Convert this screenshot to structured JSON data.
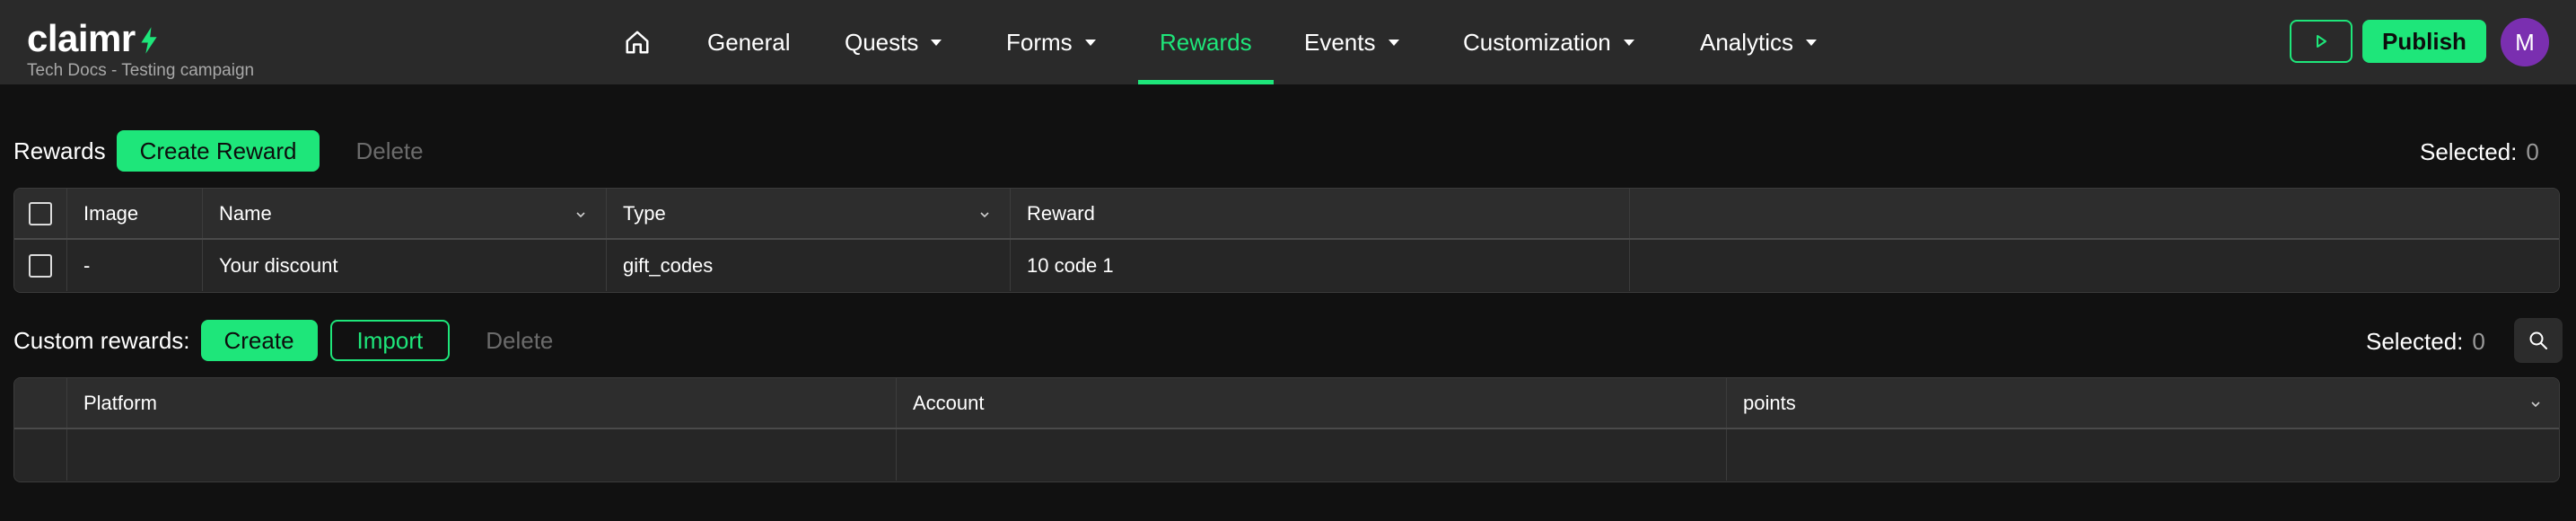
{
  "header": {
    "logo_text": "claimr",
    "subtitle": "Tech Docs - Testing campaign",
    "nav": [
      {
        "label": "General",
        "caret": false
      },
      {
        "label": "Quests",
        "caret": true
      },
      {
        "label": "Forms",
        "caret": true
      },
      {
        "label": "Rewards",
        "caret": false,
        "active": true
      },
      {
        "label": "Events",
        "caret": true
      },
      {
        "label": "Customization",
        "caret": true
      },
      {
        "label": "Analytics",
        "caret": true
      }
    ],
    "publish_label": "Publish",
    "avatar_initial": "M"
  },
  "rewards": {
    "label": "Rewards",
    "create_label": "Create Reward",
    "delete_label": "Delete",
    "selected_label": "Selected:",
    "selected_count": "0",
    "columns": [
      "Image",
      "Name",
      "Type",
      "Reward"
    ],
    "rows": [
      {
        "image": "-",
        "name": "Your discount",
        "type": "gift_codes",
        "reward": "10 code 1"
      }
    ]
  },
  "custom_rewards": {
    "label": "Custom rewards:",
    "create_label": "Create",
    "import_label": "Import",
    "delete_label": "Delete",
    "selected_label": "Selected:",
    "selected_count": "0",
    "columns": [
      "Platform",
      "Account",
      "points"
    ]
  },
  "colors": {
    "accent": "#1ee67a",
    "background": "#111111",
    "topbar": "#2a2a2a",
    "avatar": "#7a2fb0"
  },
  "icons": [
    "home-icon",
    "lightning-bolt-icon",
    "play-icon",
    "search-icon",
    "chevron-down-icon"
  ]
}
